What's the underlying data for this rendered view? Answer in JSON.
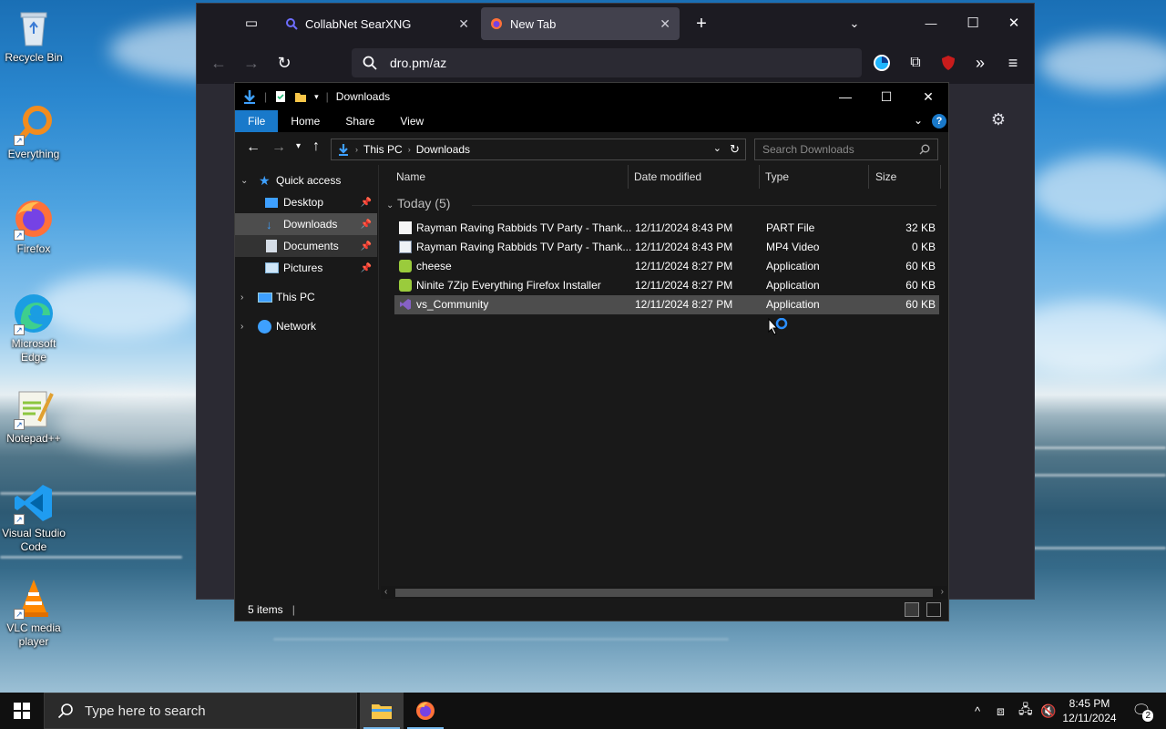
{
  "desktop_icons": [
    {
      "label": "Recycle Bin",
      "icon": "recycle-bin-icon"
    },
    {
      "label": "Everything",
      "icon": "everything-search-icon"
    },
    {
      "label": "Firefox",
      "icon": "firefox-icon"
    },
    {
      "label": "Microsoft Edge",
      "icon": "edge-icon"
    },
    {
      "label": "Notepad++",
      "icon": "notepadpp-icon"
    },
    {
      "label": "Visual Studio Code",
      "icon": "vscode-icon"
    },
    {
      "label": "VLC media player",
      "icon": "vlc-icon"
    }
  ],
  "firefox": {
    "tabs": [
      {
        "title": "CollabNet SearXNG",
        "close": "✕"
      },
      {
        "title": "New Tab",
        "close": "✕"
      }
    ],
    "new_tab": "+",
    "url": "dro.pm/az",
    "win_min": "—",
    "win_max": "☐",
    "win_close": "✕"
  },
  "explorer": {
    "title": "Downloads",
    "ribbon_tabs": [
      "File",
      "Home",
      "Share",
      "View"
    ],
    "help": "?",
    "breadcrumb": [
      "This PC",
      "Downloads"
    ],
    "search_placeholder": "Search Downloads",
    "nav": {
      "quick_access": "Quick access",
      "desktop": "Desktop",
      "downloads": "Downloads",
      "documents": "Documents",
      "pictures": "Pictures",
      "this_pc": "This PC",
      "network": "Network"
    },
    "columns": {
      "name": "Name",
      "date": "Date modified",
      "type": "Type",
      "size": "Size"
    },
    "group": "Today (5)",
    "files": [
      {
        "name": "Rayman Raving Rabbids TV Party - Thank...",
        "date": "12/11/2024 8:43 PM",
        "type": "PART File",
        "size": "32 KB",
        "icon": "blank-file-icon"
      },
      {
        "name": "Rayman Raving Rabbids TV Party - Thank...",
        "date": "12/11/2024 8:43 PM",
        "type": "MP4 Video",
        "size": "0 KB",
        "icon": "video-file-icon"
      },
      {
        "name": "cheese",
        "date": "12/11/2024 8:27 PM",
        "type": "Application",
        "size": "60 KB",
        "icon": "ninite-icon"
      },
      {
        "name": "Ninite 7Zip Everything Firefox Installer",
        "date": "12/11/2024 8:27 PM",
        "type": "Application",
        "size": "60 KB",
        "icon": "ninite-icon"
      },
      {
        "name": "vs_Community",
        "date": "12/11/2024 8:27 PM",
        "type": "Application",
        "size": "60 KB",
        "icon": "visual-studio-icon"
      }
    ],
    "status": "5 items"
  },
  "taskbar": {
    "search_placeholder": "Type here to search",
    "time": "8:45 PM",
    "date": "12/11/2024",
    "notifications": "2"
  }
}
